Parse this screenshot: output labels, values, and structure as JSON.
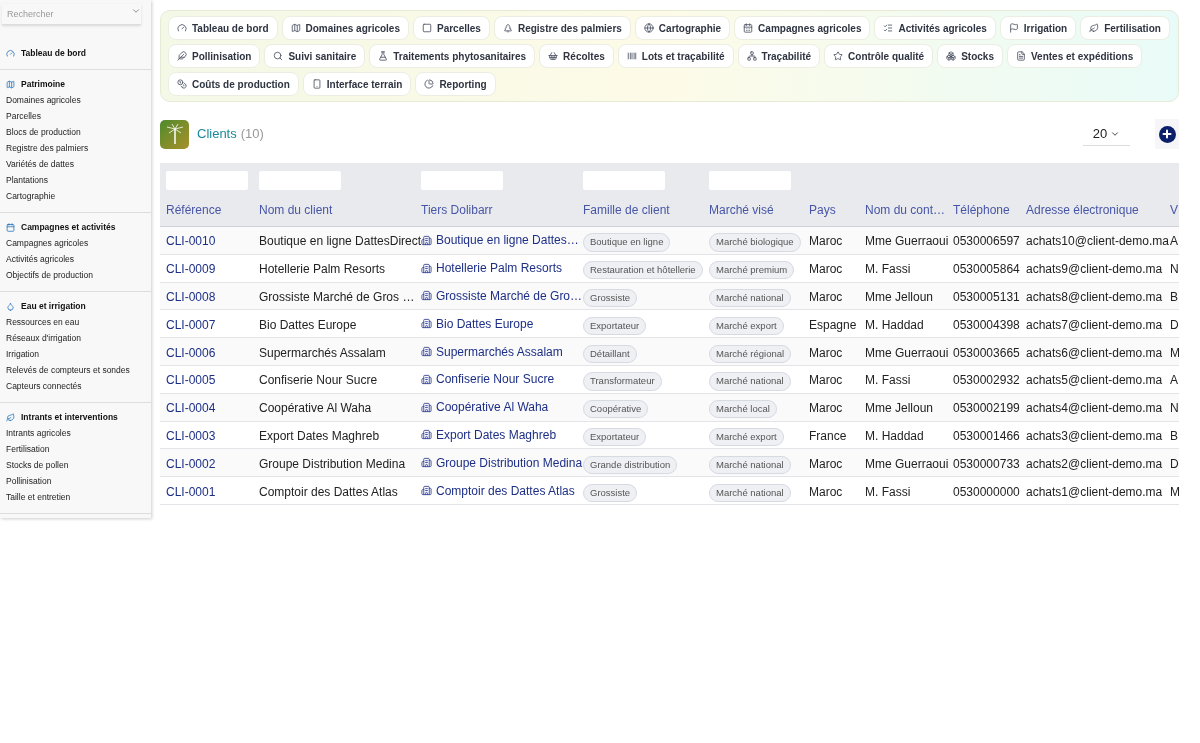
{
  "search": {
    "placeholder": "Rechercher"
  },
  "sidebar": [
    {
      "heading": "Tableau de bord"
    },
    {
      "heading": "Patrimoine",
      "items": [
        "Domaines agricoles",
        "Parcelles",
        "Blocs de production",
        "Registre des palmiers",
        "Variétés de dattes",
        "Plantations",
        "Cartographie"
      ]
    },
    {
      "heading": "Campagnes et activités",
      "items": [
        "Campagnes agricoles",
        "Activités agricoles",
        "Objectifs de production"
      ]
    },
    {
      "heading": "Eau et irrigation",
      "items": [
        "Ressources en eau",
        "Réseaux d'irrigation",
        "Irrigation",
        "Relevés de compteurs et sondes",
        "Capteurs connectés"
      ]
    },
    {
      "heading": "Intrants et interventions",
      "items": [
        "Intrants agricoles",
        "Fertilisation",
        "Stocks de pollen",
        "Pollinisation",
        "Taille et entretien"
      ]
    }
  ],
  "nav": [
    "Tableau de bord",
    "Domaines agricoles",
    "Parcelles",
    "Registre des palmiers",
    "Cartographie",
    "Campagnes agricoles",
    "Activités agricoles",
    "Irrigation",
    "Fertilisation",
    "Pollinisation",
    "Suivi sanitaire",
    "Traitements phytosanitaires",
    "Récoltes",
    "Lots et traçabilité",
    "Traçabilité",
    "Contrôle qualité",
    "Stocks",
    "Ventes et expéditions",
    "Coûts de production",
    "Interface terrain",
    "Reporting"
  ],
  "page": {
    "title": "Clients",
    "count": "(10)",
    "page_size": "20"
  },
  "table": {
    "columns": [
      {
        "label": "Référence",
        "kind": "link",
        "filter": true
      },
      {
        "label": "Nom du client",
        "kind": "text",
        "filter": true
      },
      {
        "label": "Tiers Dolibarr",
        "kind": "tiers",
        "filter": true
      },
      {
        "label": "Famille de client",
        "kind": "chip",
        "filter": true
      },
      {
        "label": "Marché visé",
        "kind": "chip",
        "filter": true
      },
      {
        "label": "Pays",
        "kind": "text",
        "filter": false
      },
      {
        "label": "Nom du cont…",
        "kind": "text",
        "filter": false
      },
      {
        "label": "Téléphone",
        "kind": "text",
        "filter": false
      },
      {
        "label": "Adresse électronique",
        "kind": "text",
        "filter": false
      },
      {
        "label": "V",
        "kind": "text",
        "filter": false
      }
    ],
    "rows": [
      [
        "CLI-0010",
        "Boutique en ligne DattesDirect",
        "Boutique en ligne Dattes…",
        "Boutique en ligne",
        "Marché biologique",
        "Maroc",
        "Mme Guerraoui",
        "0530006597",
        "achats10@client-demo.ma",
        "A"
      ],
      [
        "CLI-0009",
        "Hotellerie Palm Resorts",
        "Hotellerie Palm Resorts",
        "Restauration et hôtellerie",
        "Marché premium",
        "Maroc",
        "M. Fassi",
        "0530005864",
        "achats9@client-demo.ma",
        "N"
      ],
      [
        "CLI-0008",
        "Grossiste Marché de Gros …",
        "Grossiste Marché de Gro…",
        "Grossiste",
        "Marché national",
        "Maroc",
        "Mme Jelloun",
        "0530005131",
        "achats8@client-demo.ma",
        "B"
      ],
      [
        "CLI-0007",
        "Bio Dattes Europe",
        "Bio Dattes Europe",
        "Exportateur",
        "Marché export",
        "Espagne",
        "M. Haddad",
        "0530004398",
        "achats7@client-demo.ma",
        "D"
      ],
      [
        "CLI-0006",
        "Supermarchés Assalam",
        "Supermarchés Assalam",
        "Détaillant",
        "Marché régional",
        "Maroc",
        "Mme Guerraoui",
        "0530003665",
        "achats6@client-demo.ma",
        "M"
      ],
      [
        "CLI-0005",
        "Confiserie Nour Sucre",
        "Confiserie Nour Sucre",
        "Transformateur",
        "Marché national",
        "Maroc",
        "M. Fassi",
        "0530002932",
        "achats5@client-demo.ma",
        "A"
      ],
      [
        "CLI-0004",
        "Coopérative Al Waha",
        "Coopérative Al Waha",
        "Coopérative",
        "Marché local",
        "Maroc",
        "Mme Jelloun",
        "0530002199",
        "achats4@client-demo.ma",
        "N"
      ],
      [
        "CLI-0003",
        "Export Dates Maghreb",
        "Export Dates Maghreb",
        "Exportateur",
        "Marché export",
        "France",
        "M. Haddad",
        "0530001466",
        "achats3@client-demo.ma",
        "B"
      ],
      [
        "CLI-0002",
        "Groupe Distribution Medina",
        "Groupe Distribution Medina",
        "Grande distribution",
        "Marché national",
        "Maroc",
        "Mme Guerraoui",
        "0530000733",
        "achats2@client-demo.ma",
        "D"
      ],
      [
        "CLI-0001",
        "Comptoir des Dattes Atlas",
        "Comptoir des Dattes Atlas",
        "Grossiste",
        "Marché national",
        "Maroc",
        "M. Fassi",
        "0530000000",
        "achats1@client-demo.ma",
        "M"
      ]
    ]
  }
}
